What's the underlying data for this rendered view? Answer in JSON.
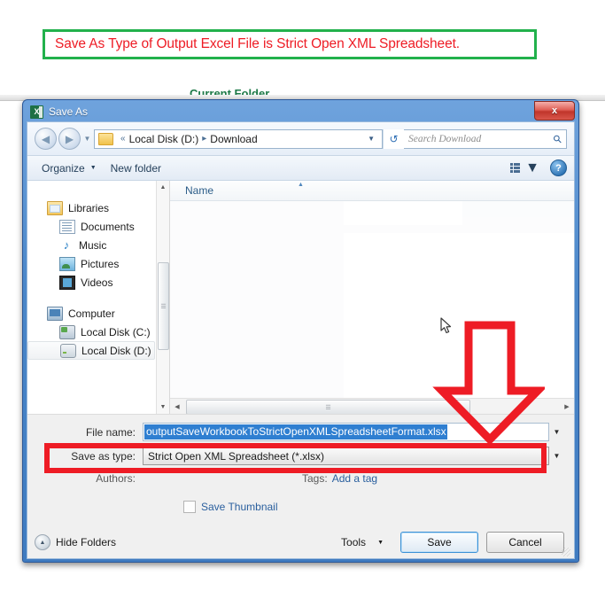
{
  "banner": {
    "text": "Save As Type of Output Excel File is Strict Open XML Spreadsheet.",
    "border_color": "#22b14c",
    "text_color": "#ee1c25"
  },
  "background": {
    "current_folder_label": "Current Folder"
  },
  "dialog": {
    "title": "Save As",
    "app_icon": "excel-icon",
    "close_label": "x",
    "address": {
      "back_icon": "back-arrow-icon",
      "forward_icon": "forward-arrow-icon",
      "crumb_separator": "«",
      "crumb_drive": "Local Disk (D:)",
      "crumb_arrow": "▸",
      "crumb_folder": "Download",
      "dropdown_icon": "chevron-down-icon",
      "refresh_icon": "refresh-icon",
      "search_placeholder": "Search Download",
      "search_value": "",
      "search_icon": "search-icon"
    },
    "commandbar": {
      "organize": "Organize",
      "new_folder": "New folder",
      "view_icon": "view-list-icon",
      "view_caret": "▼",
      "help": "?"
    },
    "navpane": {
      "items": [
        {
          "label": "Libraries",
          "icon": "libraries-icon",
          "level": 0,
          "selected": false
        },
        {
          "label": "Documents",
          "icon": "documents-icon",
          "level": 1,
          "selected": false
        },
        {
          "label": "Music",
          "icon": "music-icon",
          "level": 1,
          "selected": false
        },
        {
          "label": "Pictures",
          "icon": "pictures-icon",
          "level": 1,
          "selected": false
        },
        {
          "label": "Videos",
          "icon": "videos-icon",
          "level": 1,
          "selected": false
        },
        {
          "label": "Computer",
          "icon": "computer-icon",
          "level": 0,
          "selected": false
        },
        {
          "label": "Local Disk (C:)",
          "icon": "disk-c-icon",
          "level": 1,
          "selected": false
        },
        {
          "label": "Local Disk (D:)",
          "icon": "disk-d-icon",
          "level": 1,
          "selected": true
        }
      ]
    },
    "filelist": {
      "column_header": "Name",
      "sort_indicator": "▲",
      "rows": []
    },
    "form": {
      "filename_label": "File name:",
      "filename_value": "outputSaveWorkbookToStrictOpenXMLSpreadsheetFormat.xlsx",
      "filename_selected": true,
      "savetype_label": "Save as type:",
      "savetype_value": "Strict Open XML Spreadsheet (*.xlsx)",
      "authors_label": "Authors:",
      "authors_value": "",
      "tags_label": "Tags:",
      "tags_value": "Add a tag",
      "thumbnail_label": "Save Thumbnail",
      "thumbnail_checked": false
    },
    "buttons": {
      "hide_folders": "Hide Folders",
      "tools": "Tools",
      "tools_caret": "▼",
      "save": "Save",
      "cancel": "Cancel"
    }
  },
  "annotations": {
    "highlight_color": "#ee1c25",
    "arrow_name": "down-arrow-annotation",
    "rect_name": "save-as-type-highlight"
  }
}
